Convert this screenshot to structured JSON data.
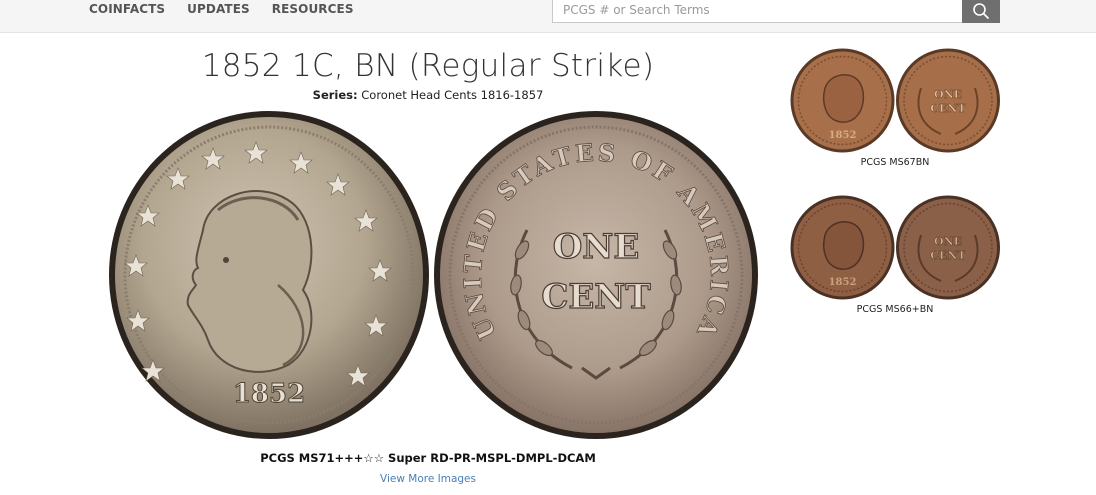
{
  "nav": {
    "items": [
      {
        "label": "COINFACTS"
      },
      {
        "label": "UPDATES"
      },
      {
        "label": "RESOURCES"
      }
    ]
  },
  "search": {
    "placeholder": "PCGS # or Search Terms",
    "button_icon": "search-icon"
  },
  "coin": {
    "title": "1852 1C, BN (Regular Strike)",
    "series_label": "Series:",
    "series_value": "Coronet Head Cents 1816-1857",
    "obverse": {
      "date": "1852",
      "icon": "coin-obverse-image"
    },
    "reverse": {
      "line1": "ONE",
      "line2": "CENT",
      "legend": "UNITED STATES OF AMERICA",
      "icon": "coin-reverse-image"
    },
    "main_grade": "PCGS MS71+++☆☆ Super RD-PR-MSPL-DMPL-DCAM",
    "view_more": "View More Images"
  },
  "thumbnails": [
    {
      "grade": "PCGS MS67BN"
    },
    {
      "grade": "PCGS MS66+BN"
    }
  ],
  "colors": {
    "nav_text": "#555555",
    "search_button": "#6f6f6f",
    "link": "#4a7fb5",
    "coin_main": "#b8ab98",
    "coin_copper": "#a8704a"
  }
}
